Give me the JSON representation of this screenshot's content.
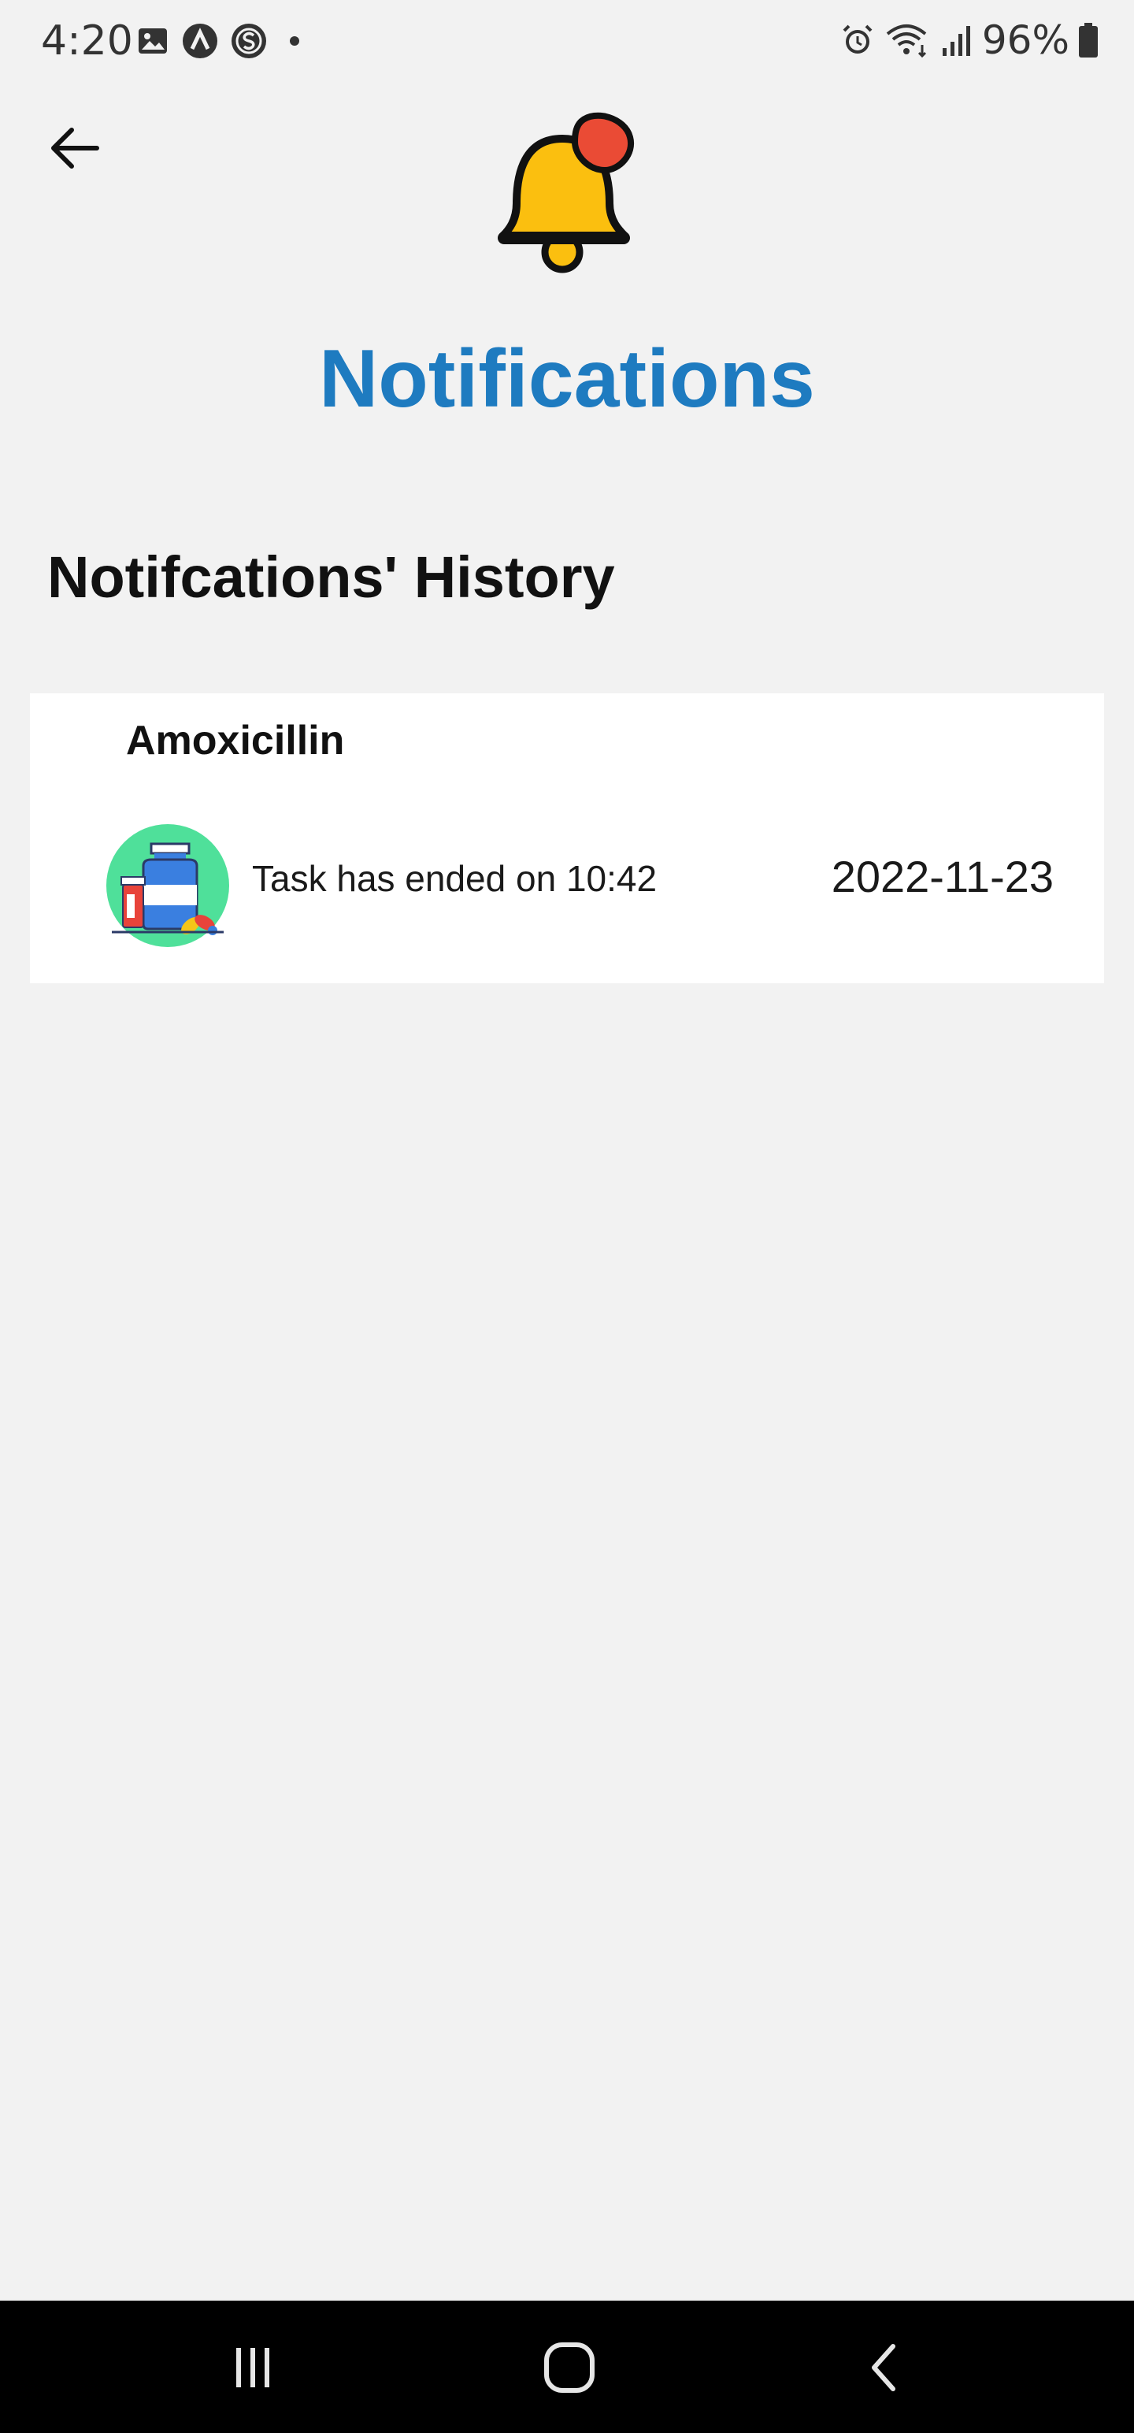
{
  "status_bar": {
    "time": "4:20",
    "battery": "96%",
    "icons_left": [
      "gallery-icon",
      "app-a-icon",
      "app-s-icon",
      "dot-icon"
    ],
    "icons_right": [
      "alarm-icon",
      "wifi-icon",
      "signal-icon",
      "battery-icon"
    ]
  },
  "header": {
    "title": "Notifications",
    "back_icon": "arrow-left-icon",
    "bell_icon": "bell-icon"
  },
  "section": {
    "title": "Notifcations' History"
  },
  "notifications": [
    {
      "title": "Amoxicillin",
      "message": "Task has ended on 10:42",
      "date": "2022-11-23",
      "icon": "medicine-bottle-icon"
    }
  ],
  "colors": {
    "accent": "#1e7bc0",
    "background": "#f2f2f2",
    "bell": "#fbbf0f",
    "bell_dot": "#ea4b35"
  },
  "nav_bar": {
    "buttons": [
      "recents-icon",
      "home-icon",
      "back-icon"
    ]
  }
}
